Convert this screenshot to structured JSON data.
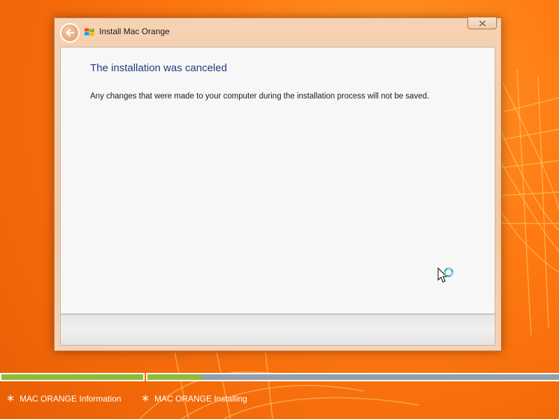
{
  "window": {
    "title": "Install Mac Orange",
    "back_icon": "back-arrow-icon",
    "close_icon": "close-icon"
  },
  "content": {
    "heading": "The installation was canceled",
    "message": "Any changes that were made to your computer during the installation process will not be saved."
  },
  "progress": {
    "steps": [
      {
        "label": "MAC ORANGE Information",
        "progress": 1.0
      },
      {
        "label": "MAC ORANGE Installing",
        "progress": 0.13
      }
    ]
  },
  "colors": {
    "background": "#f46a0a",
    "heading": "#1e3f78",
    "progress_fill": "#8dbb3f",
    "progress_track": "#8fa1ae"
  }
}
